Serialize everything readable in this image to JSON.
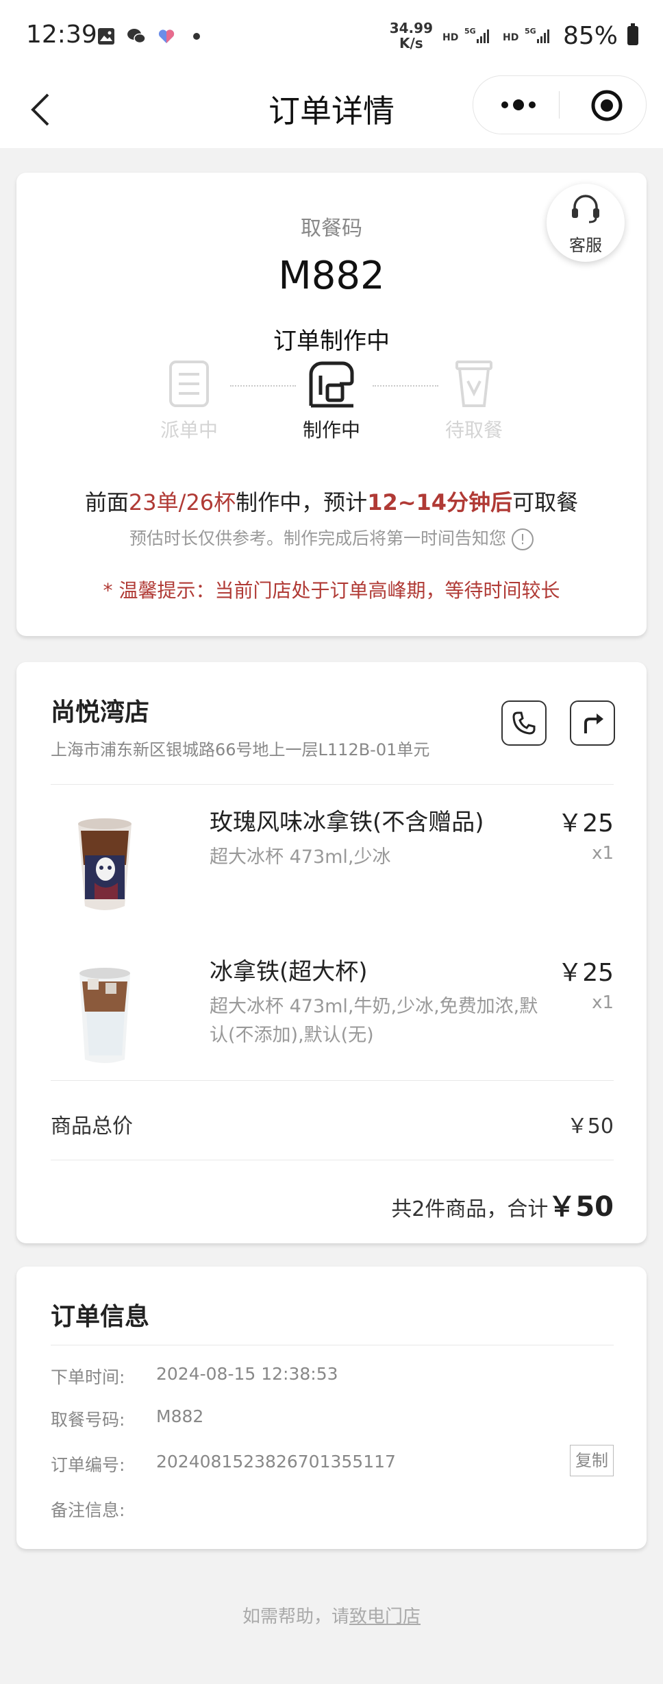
{
  "status_bar": {
    "time": "12:39",
    "speed_value": "34.99",
    "speed_unit": "K/s",
    "battery": "85%"
  },
  "nav": {
    "title": "订单详情"
  },
  "pickup": {
    "label": "取餐码",
    "code": "M882",
    "status": "订单制作中",
    "service_label": "客服",
    "steps": [
      {
        "label": "派单中",
        "state": "done"
      },
      {
        "label": "制作中",
        "state": "active"
      },
      {
        "label": "待取餐",
        "state": "pending"
      }
    ],
    "queue": {
      "prefix": "前面",
      "orders": "23单",
      "slash": "/",
      "cups": "26杯",
      "mid": "制作中，预计",
      "eta": "12~14分钟后",
      "suffix": "可取餐"
    },
    "note": "预估时长仅供参考。制作完成后将第一时间告知您",
    "info_glyph": "!",
    "tip": "* 温馨提示：当前门店处于订单高峰期，等待时间较长"
  },
  "store": {
    "name": "尚悦湾店",
    "address": "上海市浦东新区银城路66号地上一层L112B-01单元"
  },
  "items": [
    {
      "name": "玫瑰风味冰拿铁(不含赠品)",
      "spec": "超大冰杯 473ml,少冰",
      "price": "￥25",
      "qty": "x1"
    },
    {
      "name": "冰拿铁(超大杯)",
      "spec": "超大冰杯 473ml,牛奶,少冰,免费加浓,默认(不添加),默认(无)",
      "price": "￥25",
      "qty": "x1"
    }
  ],
  "summary": {
    "subtotal_label": "商品总价",
    "subtotal_value": "￥50",
    "total_prefix": "共2件商品，合计",
    "total_value": "￥50"
  },
  "order_info": {
    "title": "订单信息",
    "rows": [
      {
        "key": "下单时间:",
        "value": "2024-08-15 12:38:53"
      },
      {
        "key": "取餐号码:",
        "value": "M882"
      },
      {
        "key": "订单编号:",
        "value": "20240815238267013551​17"
      },
      {
        "key": "备注信息:",
        "value": ""
      }
    ],
    "copy_label": "复制"
  },
  "footer": {
    "text": "如需帮助，请",
    "link": "致电门店"
  },
  "colors": {
    "accent_red": "#b03a35",
    "muted": "#999999",
    "background": "#f2f2f2"
  }
}
